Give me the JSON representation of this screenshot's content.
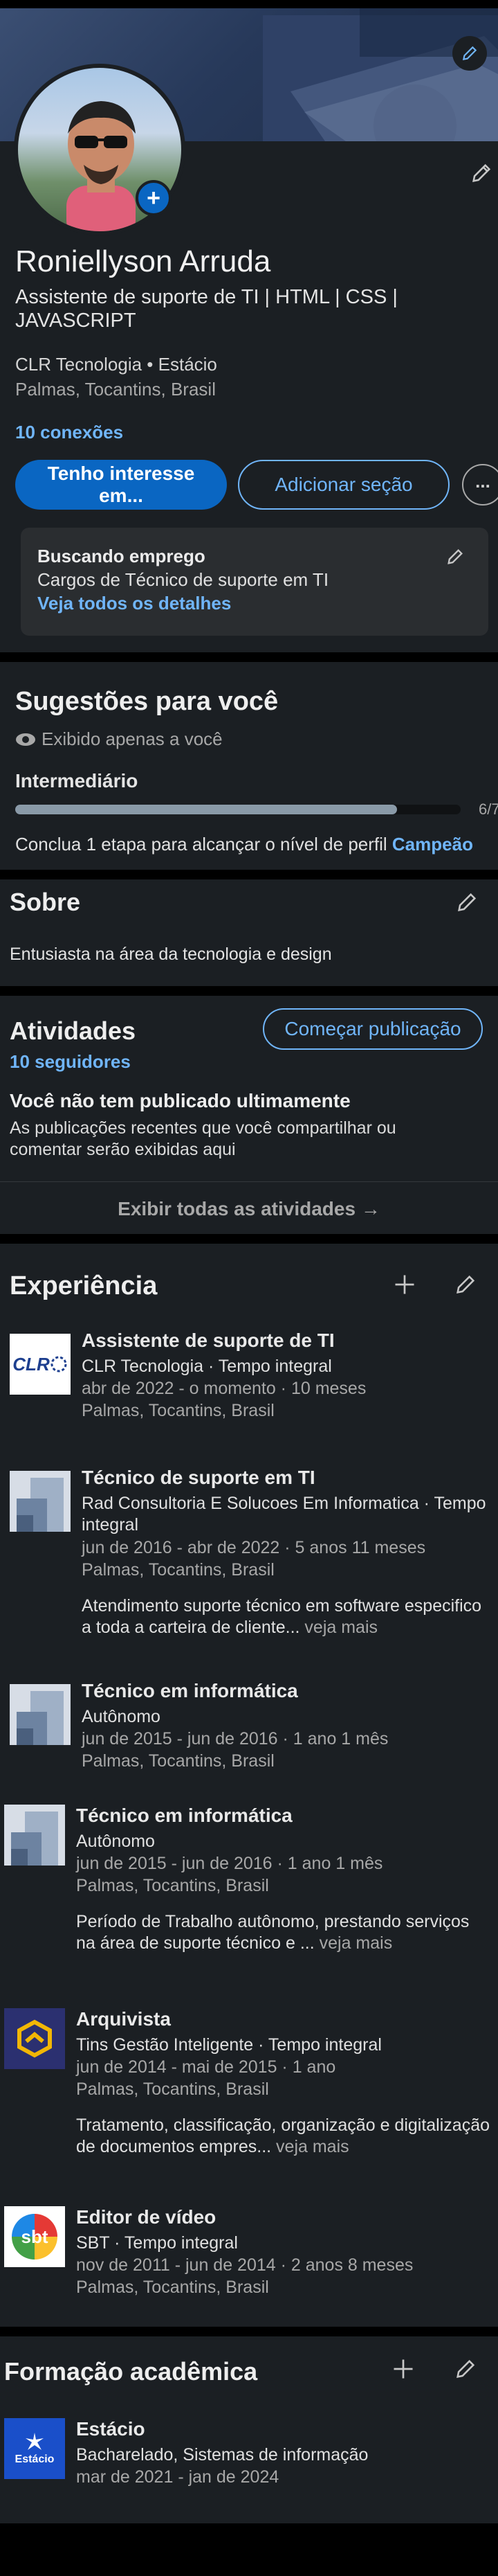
{
  "profile": {
    "name": "Roniellyson Arruda",
    "headline": "Assistente de suporte de TI | HTML | CSS | JAVASCRIPT",
    "company_line": "CLR Tecnologia • Estácio",
    "location": "Palmas, Tocantins, Brasil",
    "connections": "10 conexões",
    "primary_button": "Tenho interesse em...",
    "secondary_button": "Adicionar seção",
    "more_button": "..."
  },
  "job_seeking": {
    "title": "Buscando emprego",
    "subtitle": "Cargos de Técnico de suporte em TI",
    "link": "Veja todos os detalhes"
  },
  "suggestions": {
    "title": "Sugestões para você",
    "visibility": "Exibido apenas a você",
    "level": "Intermediário",
    "progress_label": "6/7",
    "progress_value": 0.857,
    "message_prefix": "Conclua 1 etapa para alcançar o nível de perfil",
    "message_link": "Campeão"
  },
  "about": {
    "title": "Sobre",
    "text": "Entusiasta na área da tecnologia e design"
  },
  "activity": {
    "title": "Atividades",
    "followers": "10 seguidores",
    "start_post_button": "Começar publicação",
    "empty_title": "Você não tem publicado ultimamente",
    "empty_text": "As publicações recentes que você compartilhar ou comentar serão exibidas aqui",
    "show_all": "Exibir todas as atividades →"
  },
  "experience": {
    "title": "Experiência",
    "items": [
      {
        "title": "Assistente de suporte de TI",
        "company": "CLR Tecnologia · Tempo integral",
        "dates": "abr de 2022 - o momento · 10 meses",
        "location": "Palmas, Tocantins, Brasil",
        "logo": "clr-logo",
        "logo_text": "CLR"
      },
      {
        "title": "Técnico de suporte em TI",
        "company": "Rad Consultoria E Solucoes Em Informatica · Tempo integral",
        "dates": "jun de 2016 - abr de 2022 · 5 anos 11 meses",
        "location": "Palmas, Tocantins, Brasil",
        "description": "Atendimento suporte técnico em software especifico a toda a carteira de cliente...",
        "see_more": "veja mais",
        "logo": "building-placeholder-logo"
      },
      {
        "title": "Técnico em informática",
        "company": "Autônomo",
        "dates": "jun de 2015 - jun de 2016 · 1 ano 1 mês",
        "location": "Palmas, Tocantins, Brasil",
        "logo": "building-placeholder-logo"
      },
      {
        "title": "Técnico em informática",
        "company": "Autônomo",
        "dates": "jun de 2015 - jun de 2016 · 1 ano 1 mês",
        "location": "Palmas, Tocantins, Brasil",
        "description": "Período de Trabalho autônomo, prestando serviços na área de suporte técnico e ...",
        "see_more": "veja mais",
        "logo": "building-placeholder-logo"
      },
      {
        "title": "Arquivista",
        "company": "Tins Gestão Inteligente · Tempo integral",
        "dates": "jun de 2014 - mai de 2015 · 1 ano",
        "location": "Palmas, Tocantins, Brasil",
        "description": "Tratamento, classificação, organização e digitalização de documentos empres...",
        "see_more": "veja mais",
        "logo": "tins-logo"
      },
      {
        "title": "Editor de vídeo",
        "company": "SBT · Tempo integral",
        "dates": "nov de 2011 - jun de 2014 · 2 anos 8 meses",
        "location": "Palmas, Tocantins, Brasil",
        "logo": "sbt-logo",
        "logo_text": "sbt"
      }
    ]
  },
  "education": {
    "title": "Formação acadêmica",
    "items": [
      {
        "school": "Estácio",
        "degree": "Bacharelado, Sistemas de informação",
        "dates": "mar de 2021 - jan de 2024",
        "logo_text": "Estácio"
      }
    ]
  },
  "colors": {
    "background": "#1b1f23",
    "accent": "#70b5f9",
    "primary_button": "#0a66c2",
    "progress": "#8a9aa8"
  }
}
